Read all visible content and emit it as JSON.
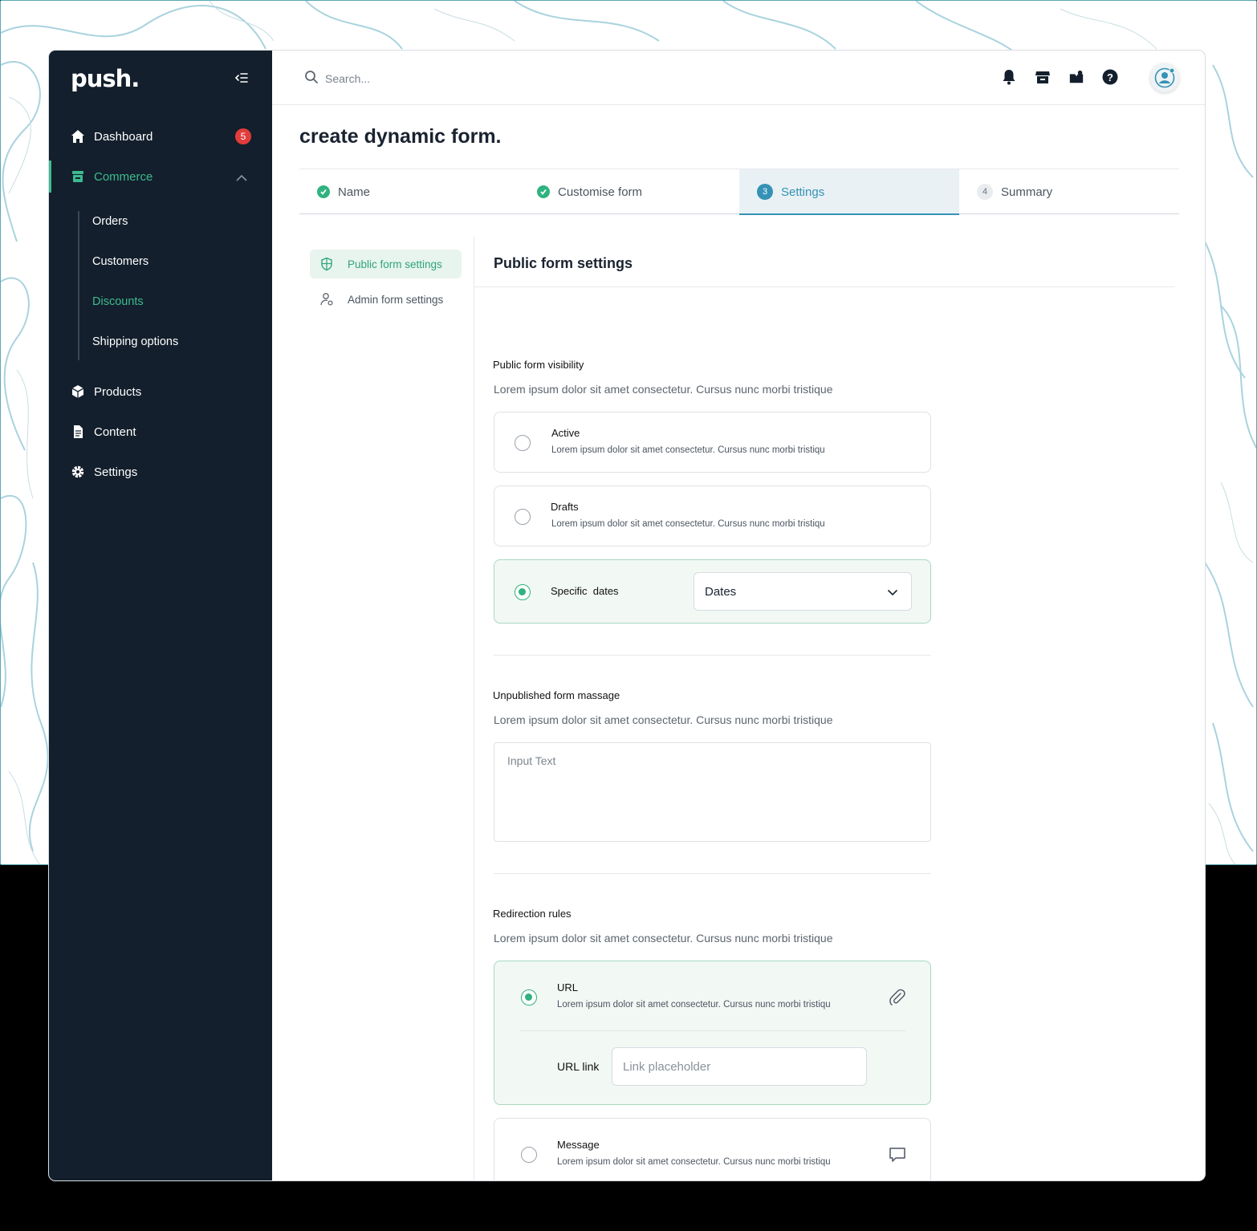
{
  "brand": {
    "logo": "push."
  },
  "sidebar": {
    "items": [
      {
        "label": "Dashboard",
        "badge": "5"
      },
      {
        "label": "Commerce"
      },
      {
        "label": "Products"
      },
      {
        "label": "Content"
      },
      {
        "label": "Settings"
      }
    ],
    "commerce_sub": [
      "Orders",
      "Customers",
      "Discounts",
      "Shipping options"
    ],
    "active_sub": "Discounts"
  },
  "topbar": {
    "search_placeholder": "Search..."
  },
  "page": {
    "title": "create dynamic form."
  },
  "steps": [
    {
      "label": "Name",
      "state": "done"
    },
    {
      "label": "Customise form",
      "state": "done"
    },
    {
      "label": "Settings",
      "number": "3",
      "state": "current"
    },
    {
      "label": "Summary",
      "number": "4",
      "state": "todo"
    }
  ],
  "settings_nav": [
    "Public form settings",
    "Admin form settings"
  ],
  "section": {
    "title": "Public form settings",
    "visibility": {
      "label": "Public form visibility",
      "desc": "Lorem ipsum dolor sit amet consectetur. Cursus nunc morbi tristique",
      "options": [
        {
          "title": "Active",
          "desc": "Lorem ipsum dolor sit amet consectetur. Cursus nunc morbi tristiqu"
        },
        {
          "title": "Drafts",
          "desc": "Lorem ipsum dolor sit amet consectetur. Cursus nunc morbi tristiqu"
        },
        {
          "title": "Specific  dates",
          "select_value": "Dates"
        }
      ],
      "selected": "Specific dates"
    },
    "unpublished": {
      "label": "Unpublished form massage",
      "desc": "Lorem ipsum dolor sit amet consectetur. Cursus nunc morbi tristique",
      "placeholder": "Input Text"
    },
    "redirection": {
      "label": "Redirection rules",
      "desc": "Lorem ipsum dolor sit amet consectetur. Cursus nunc morbi tristique",
      "url": {
        "title": "URL",
        "desc": "Lorem ipsum dolor sit amet consectetur. Cursus nunc morbi tristiqu",
        "link_label": "URL link",
        "link_placeholder": "Link placeholder"
      },
      "message": {
        "title": "Message",
        "desc": "Lorem ipsum dolor sit amet consectetur. Cursus nunc morbi tristiqu"
      },
      "selected": "URL"
    }
  },
  "colors": {
    "sidebar": "#131f2c",
    "accent_green": "#2fb37f",
    "accent_blue": "#3592b5",
    "badge_red": "#e23c3c"
  }
}
